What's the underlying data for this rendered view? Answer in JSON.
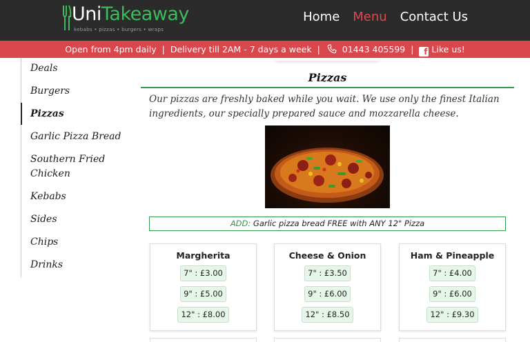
{
  "header": {
    "logo": {
      "part1": "Uni",
      "part2": "Takeaway",
      "tagline": "kebabs • pizzas • burgers • wraps"
    },
    "nav": [
      {
        "label": "Home",
        "active": false
      },
      {
        "label": "Menu",
        "active": true
      },
      {
        "label": "Contact Us",
        "active": false
      }
    ]
  },
  "infobar": {
    "hours": "Open from 4pm daily",
    "delivery": "Delivery till 2AM - 7 days a week",
    "phone": "01443 405599",
    "like": "Like us!",
    "separator": "|"
  },
  "sidebar": {
    "items": [
      {
        "label": "Deals",
        "active": false
      },
      {
        "label": "Burgers",
        "active": false
      },
      {
        "label": "Pizzas",
        "active": true
      },
      {
        "label": "Garlic Pizza Bread",
        "active": false
      },
      {
        "label": "Southern Fried Chicken",
        "active": false
      },
      {
        "label": "Kebabs",
        "active": false
      },
      {
        "label": "Sides",
        "active": false
      },
      {
        "label": "Chips",
        "active": false
      },
      {
        "label": "Drinks",
        "active": false
      }
    ]
  },
  "main": {
    "title": "Pizzas",
    "intro": "Our pizzas are freshly baked while you wait. We use only the finest Italian ingredients, our specially prepared sauce and mozzarella cheese.",
    "addon": {
      "label": "ADD:",
      "text": "Garlic pizza bread FREE with ANY 12\" Pizza"
    },
    "products": [
      {
        "name": "Margherita",
        "prices": [
          "7\" : £3.00",
          "9\" : £5.00",
          "12\" : £8.00"
        ]
      },
      {
        "name": "Cheese & Onion",
        "prices": [
          "7\" : £3.50",
          "9\" : £6.00",
          "12\" : £8.50"
        ]
      },
      {
        "name": "Ham & Pineapple",
        "prices": [
          "7\" : £4.00",
          "9\" : £6.00",
          "12\" : £9.30"
        ]
      }
    ]
  },
  "colors": {
    "header_bg": "#2b2b2b",
    "infobar_bg": "#d9474c",
    "accent_green": "#2e9a4a",
    "nav_active": "#e0484f"
  },
  "icons": [
    "fork-knife-icon",
    "phone-icon",
    "facebook-icon"
  ]
}
